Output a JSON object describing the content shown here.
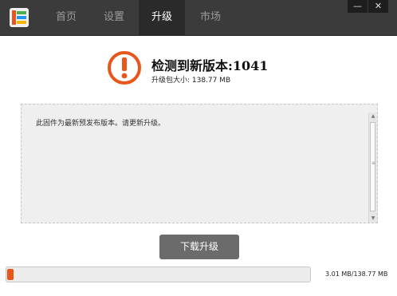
{
  "nav": {
    "tabs": [
      {
        "label": "首页"
      },
      {
        "label": "设置"
      },
      {
        "label": "升级"
      },
      {
        "label": "市场"
      }
    ],
    "active_tab": "升级"
  },
  "window_controls": {
    "minimize": "—",
    "close": "✕"
  },
  "update": {
    "headline": "检测到新版本:1041",
    "package_size": "升级包大小: 138.77 MB",
    "release_notes": "此固件为最新预发布版本。请更新升级。",
    "download_button": "下载升级"
  },
  "progress": {
    "fraction": 0.022,
    "text": "3.01 MB/138.77 MB"
  },
  "colors": {
    "accent": "#e8561c",
    "titlebar": "#3b3b3b",
    "button": "#6b6b6b"
  },
  "icons": {
    "logo": "app-logo-icon",
    "warning": "exclamation-circle-icon"
  }
}
